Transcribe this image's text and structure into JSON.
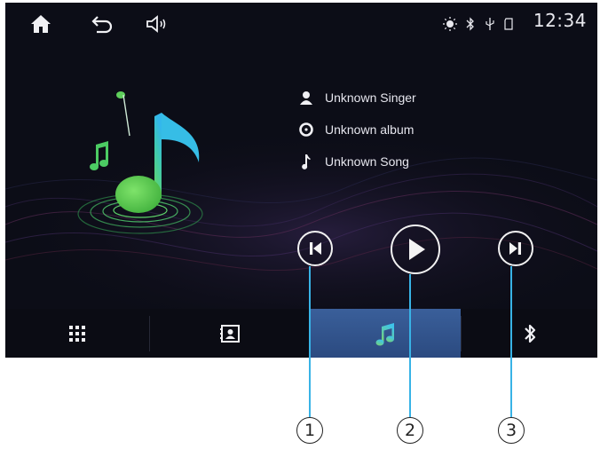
{
  "status_bar": {
    "clock": "12:34",
    "icons": [
      "home-icon",
      "back-icon",
      "volume-icon",
      "brightness-icon",
      "bluetooth-status-icon",
      "usb-icon",
      "sd-card-icon"
    ]
  },
  "music_info": {
    "singer": "Unknown Singer",
    "album": "Unknown album",
    "song": "Unknown Song"
  },
  "controls": [
    "previous-track",
    "play",
    "next-track"
  ],
  "bottom_tabs": [
    {
      "name": "apps",
      "icon": "grid-icon",
      "active": false
    },
    {
      "name": "contacts",
      "icon": "contact-card-icon",
      "active": false
    },
    {
      "name": "music",
      "icon": "music-note-icon",
      "active": true
    },
    {
      "name": "bluetooth",
      "icon": "bluetooth-icon",
      "active": false
    }
  ],
  "callouts": {
    "one": "1",
    "two": "2",
    "three": "3"
  },
  "colors": {
    "screen_bg": "#0c0d17",
    "active_tab": "#3a5f9a",
    "callout_line": "#38b3e6",
    "note_green": "#5ed46a",
    "note_cyan": "#35c2e8"
  }
}
